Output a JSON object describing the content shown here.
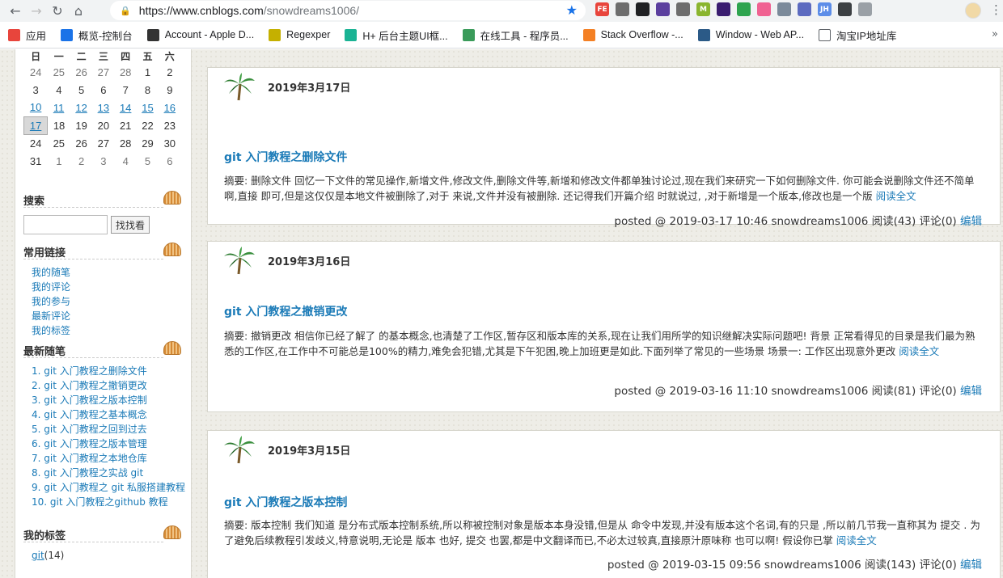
{
  "browser": {
    "url_host": "https://www.cnblogs.com",
    "url_path": "/snowdreams1006/",
    "extensions": [
      {
        "label": "FE",
        "color": "#e8453c"
      },
      {
        "label": "",
        "color": "#6d6d6d"
      },
      {
        "label": "",
        "color": "#202124"
      },
      {
        "label": "",
        "color": "#5b3f9e"
      },
      {
        "label": "",
        "color": "#6d6d6d"
      },
      {
        "label": "M",
        "color": "#8ab52f"
      },
      {
        "label": "",
        "color": "#3a1d70"
      },
      {
        "label": "",
        "color": "#2ea44f"
      },
      {
        "label": "",
        "color": "#f06292"
      },
      {
        "label": "",
        "color": "#7b8a9a"
      },
      {
        "label": "",
        "color": "#5c6bc0"
      },
      {
        "label": "JH",
        "color": "#5c8de8"
      },
      {
        "label": "",
        "color": "#3c4043"
      },
      {
        "label": "",
        "color": "#9aa0a6"
      }
    ],
    "bookmarks": [
      {
        "label": "应用",
        "icon": "apps-grid-icon",
        "color": "#e8453c"
      },
      {
        "label": "概览-控制台",
        "icon": "cloud-icon",
        "color": "#1a73e8"
      },
      {
        "label": "Account - Apple D...",
        "icon": "apple-icon",
        "color": "#333333"
      },
      {
        "label": "Regexper",
        "icon": "regexper-icon",
        "color": "#c5b000"
      },
      {
        "label": "H+ 后台主题UI框...",
        "icon": "hplus-icon",
        "color": "#1ab394"
      },
      {
        "label": "在线工具 - 程序员...",
        "icon": "tools-icon",
        "color": "#3a9b5a"
      },
      {
        "label": "Stack Overflow -...",
        "icon": "stackoverflow-icon",
        "color": "#f48024"
      },
      {
        "label": "Window - Web AP...",
        "icon": "mdn-icon",
        "color": "#2b5a87"
      },
      {
        "label": "淘宝IP地址库",
        "icon": "document-icon",
        "color": "#ffffff"
      }
    ]
  },
  "calendar": {
    "weekdays": [
      "日",
      "一",
      "二",
      "三",
      "四",
      "五",
      "六"
    ],
    "weeks": [
      [
        {
          "d": "24",
          "t": "other"
        },
        {
          "d": "25",
          "t": "other"
        },
        {
          "d": "26",
          "t": "other"
        },
        {
          "d": "27",
          "t": "other"
        },
        {
          "d": "28",
          "t": "other"
        },
        {
          "d": "1",
          "t": ""
        },
        {
          "d": "2",
          "t": ""
        }
      ],
      [
        {
          "d": "3",
          "t": ""
        },
        {
          "d": "4",
          "t": ""
        },
        {
          "d": "5",
          "t": ""
        },
        {
          "d": "6",
          "t": ""
        },
        {
          "d": "7",
          "t": ""
        },
        {
          "d": "8",
          "t": ""
        },
        {
          "d": "9",
          "t": ""
        }
      ],
      [
        {
          "d": "10",
          "t": "link"
        },
        {
          "d": "11",
          "t": "link"
        },
        {
          "d": "12",
          "t": "link"
        },
        {
          "d": "13",
          "t": "link"
        },
        {
          "d": "14",
          "t": "link"
        },
        {
          "d": "15",
          "t": "link"
        },
        {
          "d": "16",
          "t": "link"
        }
      ],
      [
        {
          "d": "17",
          "t": "link today"
        },
        {
          "d": "18",
          "t": ""
        },
        {
          "d": "19",
          "t": ""
        },
        {
          "d": "20",
          "t": ""
        },
        {
          "d": "21",
          "t": ""
        },
        {
          "d": "22",
          "t": ""
        },
        {
          "d": "23",
          "t": ""
        }
      ],
      [
        {
          "d": "24",
          "t": ""
        },
        {
          "d": "25",
          "t": ""
        },
        {
          "d": "26",
          "t": ""
        },
        {
          "d": "27",
          "t": ""
        },
        {
          "d": "28",
          "t": ""
        },
        {
          "d": "29",
          "t": ""
        },
        {
          "d": "30",
          "t": ""
        }
      ],
      [
        {
          "d": "31",
          "t": ""
        },
        {
          "d": "1",
          "t": "other"
        },
        {
          "d": "2",
          "t": "other"
        },
        {
          "d": "3",
          "t": "other"
        },
        {
          "d": "4",
          "t": "other"
        },
        {
          "d": "5",
          "t": "other"
        },
        {
          "d": "6",
          "t": "other"
        }
      ]
    ]
  },
  "sidebar": {
    "search_title": "搜索",
    "search_button": "找找看",
    "links_title": "常用链接",
    "links": [
      "我的随笔",
      "我的评论",
      "我的参与",
      "最新评论",
      "我的标签"
    ],
    "recent_title": "最新随笔",
    "recent": [
      "1. git 入门教程之删除文件",
      "2. git 入门教程之撤销更改",
      "3. git 入门教程之版本控制",
      "4. git 入门教程之基本概念",
      "5. git 入门教程之回到过去",
      "6. git 入门教程之版本管理",
      "7. git 入门教程之本地仓库",
      "8. git 入门教程之实战 git",
      "9. git 入门教程之 git 私服搭建教程",
      "10. git 入门教程之github 教程"
    ],
    "tags_title": "我的标签",
    "tag_name": "git",
    "tag_count": "(14)"
  },
  "posts": [
    {
      "date": "2019年3月17日",
      "title": "git 入门教程之删除文件",
      "summary": "摘要: 删除文件 回忆一下文件的常见操作,新增文件,修改文件,删除文件等,新增和修改文件都单独讨论过,现在我们来研究一下如何删除文件. 你可能会说删除文件还不简单啊,直接 即可,但是这仅仅是本地文件被删除了,对于 来说,文件并没有被删除. 还记得我们开篇介绍 时就说过, ,对于新增是一个版本,修改也是一个版",
      "more": "阅读全文",
      "footer": "posted @ 2019-03-17 10:46 snowdreams1006 阅读(43) 评论(0) ",
      "edit": "编辑"
    },
    {
      "date": "2019年3月16日",
      "title": "git 入门教程之撤销更改",
      "summary": "摘要: 撤销更改 相信你已经了解了 的基本概念,也清楚了工作区,暂存区和版本库的关系,现在让我们用所学的知识继解决实际问题吧! 背景 正常看得见的目录是我们最为熟悉的工作区,在工作中不可能总是100%的精力,难免会犯错,尤其是下午犯困,晚上加班更是如此.下面列举了常见的一些场景 场景一: 工作区出现意外更改",
      "more": "阅读全文",
      "footer": "posted @ 2019-03-16 11:10 snowdreams1006 阅读(81) 评论(0) ",
      "edit": "编辑"
    },
    {
      "date": "2019年3月15日",
      "title": "git 入门教程之版本控制",
      "summary": "摘要: 版本控制 我们知道 是分布式版本控制系统,所以称被控制对象是版本本身没错,但是从 命令中发现,并没有版本这个名词,有的只是 ,所以前几节我一直称其为 提交 . 为了避免后续教程引发歧义,特意说明,无论是 版本 也好, 提交 也罢,都是中文翻译而已,不必太过较真,直接原汁原味称 也可以啊! 假设你已掌",
      "more": "阅读全文",
      "footer": "posted @ 2019-03-15 09:56 snowdreams1006 阅读(143) 评论(0) ",
      "edit": "编辑"
    }
  ]
}
